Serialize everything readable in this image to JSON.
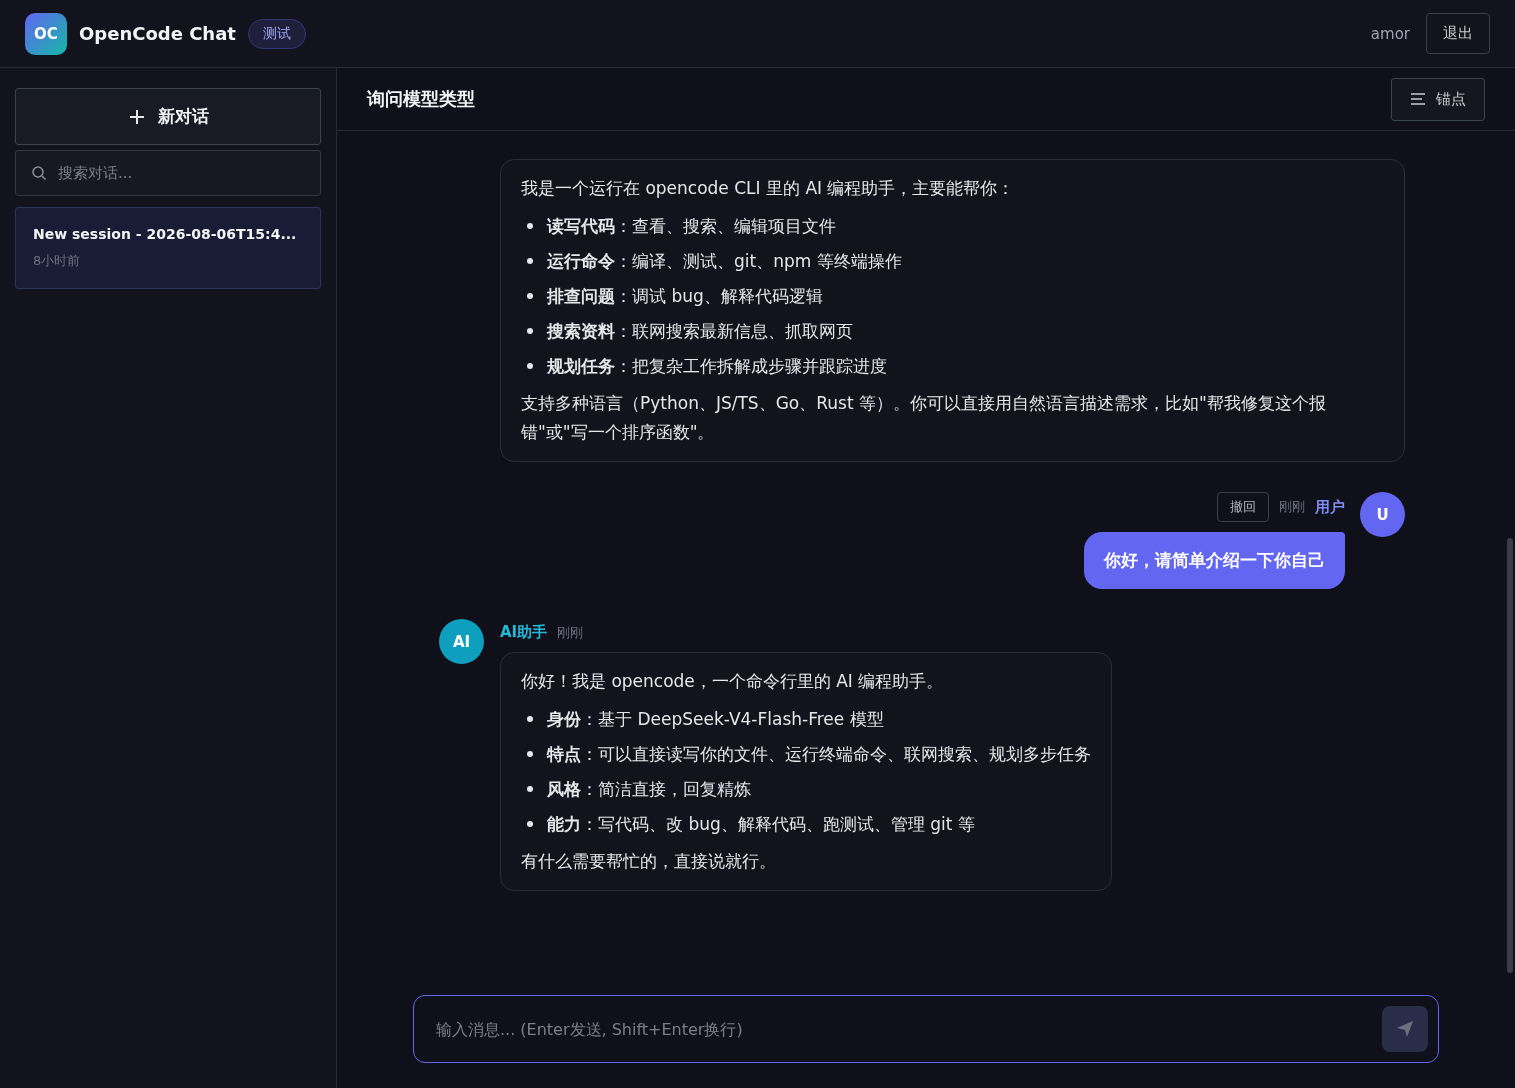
{
  "header": {
    "logo": "OC",
    "title": "OpenCode Chat",
    "badge": "测试",
    "user": "amor",
    "logout": "退出"
  },
  "sidebar": {
    "new_chat": "新对话",
    "search": {
      "placeholder": "搜索对话..."
    },
    "sessions": [
      {
        "title": "New session - 2026-08-06T15:4...",
        "time": "8小时前",
        "selected": true
      }
    ]
  },
  "chat": {
    "title": "询问模型类型",
    "anchor_button": "锚点",
    "messages": [
      {
        "kind": "ai",
        "blocks": [
          {
            "kind": "p",
            "text": "我是一个运行在 opencode CLI 里的 AI 编程助手，主要能帮你："
          },
          {
            "kind": "li",
            "text": "**读写代码**：查看、搜索、编辑项目文件"
          },
          {
            "kind": "li",
            "text": "**运行命令**：编译、测试、git、npm 等终端操作"
          },
          {
            "kind": "li",
            "text": "**排查问题**：调试 bug、解释代码逻辑"
          },
          {
            "kind": "li",
            "text": "**搜索资料**：联网搜索最新信息、抓取网页"
          },
          {
            "kind": "li",
            "text": "**规划任务**：把复杂工作拆解成步骤并跟踪进度"
          },
          {
            "kind": "p",
            "text": "支持多种语言（Python、JS/TS、Go、Rust 等）。你可以直接用自然语言描述需求，比如\"帮我修复这个报错\"或\"写一个排序函数\"。"
          }
        ]
      },
      {
        "kind": "user",
        "avatar": "U",
        "name": "用户",
        "time": "刚刚",
        "undo": "撤回",
        "text": "你好，请简单介绍一下你自己"
      },
      {
        "kind": "ai",
        "avatar": "AI",
        "name": "AI助手",
        "time": "刚刚",
        "blocks": [
          {
            "kind": "p",
            "text": "你好！我是 opencode，一个命令行里的 AI 编程助手。"
          },
          {
            "kind": "li",
            "text": "**身份**：基于 DeepSeek-V4-Flash-Free 模型"
          },
          {
            "kind": "li",
            "text": "**特点**：可以直接读写你的文件、运行终端命令、联网搜索、规划多步任务"
          },
          {
            "kind": "li",
            "text": "**风格**：简洁直接，回复精炼"
          },
          {
            "kind": "li",
            "text": "**能力**：写代码、改 bug、解释代码、跑测试、管理 git 等"
          },
          {
            "kind": "p",
            "text": "有什么需要帮忙的，直接说就行。"
          }
        ]
      }
    ],
    "input": {
      "placeholder": "输入消息... (Enter发送, Shift+Enter换行)"
    }
  }
}
